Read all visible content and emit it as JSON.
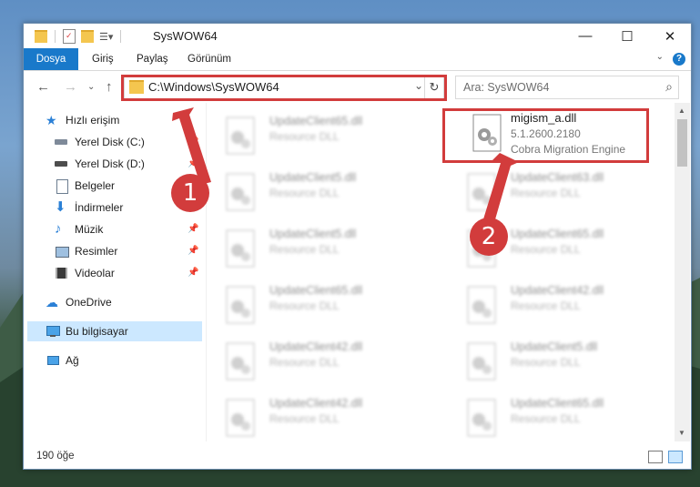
{
  "window": {
    "title": "SysWOW64"
  },
  "ribbon": {
    "tabs": [
      "Dosya",
      "Giriş",
      "Paylaş",
      "Görünüm"
    ],
    "help": "?"
  },
  "address": {
    "path": "C:\\Windows\\SysWOW64"
  },
  "search": {
    "placeholder": "Ara: SysWOW64"
  },
  "nav": {
    "quick_access": "Hızlı erişim",
    "items": [
      {
        "label": "Yerel Disk (C:)"
      },
      {
        "label": "Yerel Disk (D:)"
      },
      {
        "label": "Belgeler"
      },
      {
        "label": "İndirmeler"
      },
      {
        "label": "Müzik"
      },
      {
        "label": "Resimler"
      },
      {
        "label": "Videolar"
      }
    ],
    "onedrive": "OneDrive",
    "this_pc": "Bu bilgisayar",
    "network": "Ağ"
  },
  "files": {
    "highlighted": {
      "name": "migism_a.dll",
      "version": "5.1.2600.2180",
      "description": "Cobra Migration Engine"
    },
    "left_column": [
      {
        "name": "UpdateClient65.dll",
        "type": "Resource DLL"
      },
      {
        "name": "UpdateClient5.dll",
        "type": "Resource DLL"
      },
      {
        "name": "UpdateClient5.dll",
        "type": "Resource DLL"
      },
      {
        "name": "UpdateClient65.dll",
        "type": "Resource DLL"
      },
      {
        "name": "UpdateClient42.dll",
        "type": "Resource DLL"
      },
      {
        "name": "UpdateClient42.dll",
        "type": "Resource DLL"
      }
    ],
    "right_column": [
      {
        "name": "UpdateClient63.dll",
        "type": "Resource DLL"
      },
      {
        "name": "UpdateClient65.dll",
        "type": "Resource DLL"
      },
      {
        "name": "UpdateClient42.dll",
        "type": "Resource DLL"
      },
      {
        "name": "UpdateClient5.dll",
        "type": "Resource DLL"
      },
      {
        "name": "UpdateClient65.dll",
        "type": "Resource DLL"
      }
    ]
  },
  "status": {
    "count": "190 öğe"
  },
  "annotations": {
    "step1": "1",
    "step2": "2",
    "color": "#d23c3c"
  }
}
